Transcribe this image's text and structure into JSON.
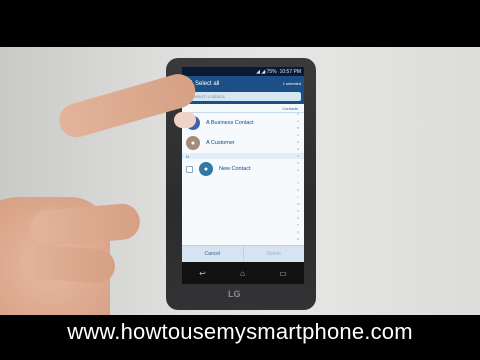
{
  "status_bar": {
    "icons": "◢ ◢ 75%",
    "time": "10:57 PM"
  },
  "action_bar": {
    "title": "Select all",
    "right_label": "1 selected"
  },
  "search": {
    "placeholder": "Search contacts",
    "icon": "search-icon"
  },
  "section": {
    "label": "Contacts"
  },
  "contacts": [
    {
      "name": "A Business Contact",
      "avatar_color": "#3d63a8"
    },
    {
      "name": "A Customer",
      "avatar_color": "#a58b7a"
    }
  ],
  "divider": {
    "letter": "N"
  },
  "contact_new": {
    "name": "New Contact",
    "avatar_color": "#2f79a8"
  },
  "bottom_actions": {
    "cancel": "Cancel",
    "delete": "Delete"
  },
  "index_letters": [
    "#",
    "A",
    "B",
    "C",
    "D",
    "E",
    "F",
    "G",
    "H",
    "I",
    "J",
    "K",
    "L",
    "M",
    "N",
    "O",
    "P",
    "Q",
    "R",
    "S",
    "T",
    "U"
  ],
  "nav": {
    "back": "↩",
    "home": "⌂",
    "recent": "▭"
  },
  "brand": "LG",
  "caption": "www.howtousemysmartphone.com"
}
